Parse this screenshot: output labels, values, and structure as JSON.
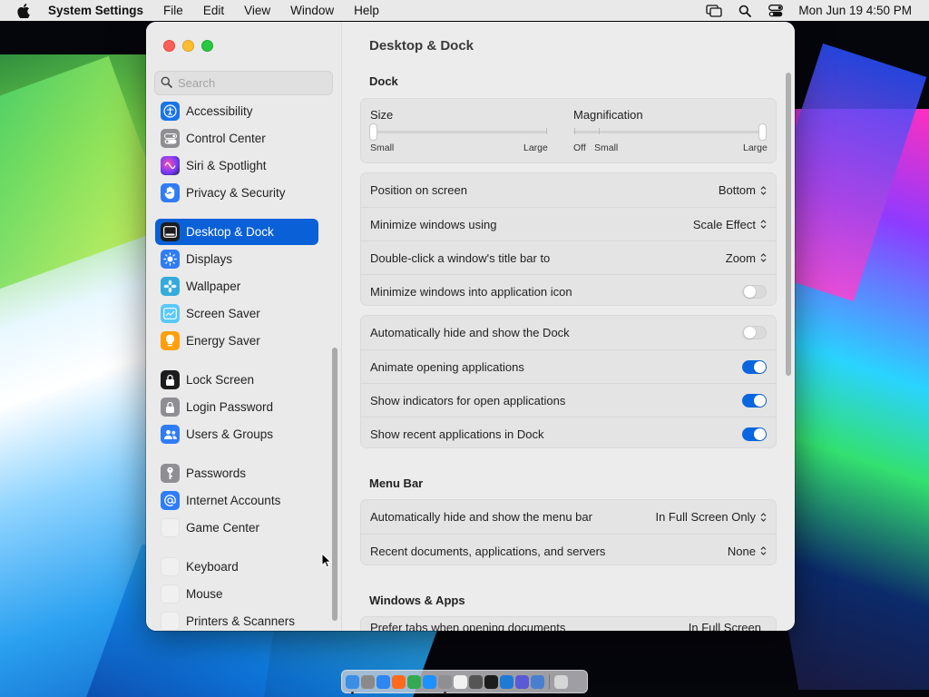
{
  "menubar": {
    "app_name": "System Settings",
    "menus": [
      "File",
      "Edit",
      "View",
      "Window",
      "Help"
    ],
    "clock": "Mon Jun 19  4:50 PM",
    "icons": [
      "apple-logo-icon",
      "screen-mirroring-icon",
      "spotlight-search-icon",
      "control-center-icon"
    ]
  },
  "sidebar": {
    "search_placeholder": "Search",
    "items": [
      {
        "label": "Accessibility",
        "icon": "accessibility-icon",
        "color": "#1a73e8"
      },
      {
        "label": "Control Center",
        "icon": "control-center-icon",
        "color": "#8e8e93"
      },
      {
        "label": "Siri & Spotlight",
        "icon": "siri-icon",
        "color": "#b04fd8"
      },
      {
        "label": "Privacy & Security",
        "icon": "hand-icon",
        "color": "#2f7cf6"
      },
      {
        "label": "Desktop & Dock",
        "icon": "dock-icon",
        "color": "#1c1c1e",
        "active": true
      },
      {
        "label": "Displays",
        "icon": "sun-icon",
        "color": "#2f7cf6"
      },
      {
        "label": "Wallpaper",
        "icon": "flower-icon",
        "color": "#35aadc"
      },
      {
        "label": "Screen Saver",
        "icon": "screen-saver-icon",
        "color": "#5ac8fa"
      },
      {
        "label": "Energy Saver",
        "icon": "lightbulb-icon",
        "color": "#ff9f0a"
      },
      {
        "label": "Lock Screen",
        "icon": "lock-screen-icon",
        "color": "#1c1c1e"
      },
      {
        "label": "Login Password",
        "icon": "lock-icon",
        "color": "#8e8e93"
      },
      {
        "label": "Users & Groups",
        "icon": "users-icon",
        "color": "#2f7cf6"
      },
      {
        "label": "Passwords",
        "icon": "key-icon",
        "color": "#8e8e93"
      },
      {
        "label": "Internet Accounts",
        "icon": "at-sign-icon",
        "color": "#2f7cf6"
      },
      {
        "label": "Game Center",
        "icon": "game-center-icon",
        "color": "#f0f0f0"
      },
      {
        "label": "Keyboard",
        "icon": "keyboard-icon",
        "color": "#f0f0f0"
      },
      {
        "label": "Mouse",
        "icon": "mouse-icon",
        "color": "#f0f0f0"
      },
      {
        "label": "Printers & Scanners",
        "icon": "printer-icon",
        "color": "#f0f0f0"
      }
    ]
  },
  "content": {
    "title": "Desktop & Dock",
    "dock_section": {
      "title": "Dock",
      "size": {
        "label": "Size",
        "min_label": "Small",
        "max_label": "Large",
        "value": 0.0
      },
      "magnification": {
        "label": "Magnification",
        "off_label": "Off",
        "min_label": "Small",
        "max_label": "Large",
        "value": 1.0
      },
      "rows": [
        {
          "label": "Position on screen",
          "value": "Bottom"
        },
        {
          "label": "Minimize windows using",
          "value": "Scale Effect"
        },
        {
          "label": "Double-click a window's title bar to",
          "value": "Zoom"
        },
        {
          "label": "Minimize windows into application icon",
          "toggle": false
        }
      ],
      "toggles": [
        {
          "label": "Automatically hide and show the Dock",
          "on": false
        },
        {
          "label": "Animate opening applications",
          "on": true
        },
        {
          "label": "Show indicators for open applications",
          "on": true
        },
        {
          "label": "Show recent applications in Dock",
          "on": true
        }
      ]
    },
    "menubar_section": {
      "title": "Menu Bar",
      "rows": [
        {
          "label": "Automatically hide and show the menu bar",
          "value": "In Full Screen Only"
        },
        {
          "label": "Recent documents, applications, and servers",
          "value": "None"
        }
      ]
    },
    "windows_section": {
      "title": "Windows & Apps",
      "partial_row": {
        "label": "Prefer tabs when opening documents",
        "value": "In Full Screen"
      }
    }
  },
  "colors": {
    "accent": "#0a60d6",
    "toggle_on": "#0a66e0",
    "close": "#fe5f57",
    "minimize": "#febc2e",
    "zoom": "#28c840"
  },
  "dock": {
    "apps": [
      {
        "name": "finder-icon",
        "color": "#3a8ee6"
      },
      {
        "name": "launchpad-icon",
        "color": "#8a8a8a"
      },
      {
        "name": "safari-icon",
        "color": "#2e86f0"
      },
      {
        "name": "firefox-icon",
        "color": "#ff6a1e"
      },
      {
        "name": "chrome-icon",
        "color": "#34a853"
      },
      {
        "name": "app-store-icon",
        "color": "#1e90ff"
      },
      {
        "name": "system-settings-icon",
        "color": "#8e8e93"
      },
      {
        "name": "textedit-icon",
        "color": "#f2f2f2"
      },
      {
        "name": "script-editor-icon",
        "color": "#555555"
      },
      {
        "name": "terminal-icon",
        "color": "#1c1c1c"
      },
      {
        "name": "vscode-icon",
        "color": "#1f7ad6"
      },
      {
        "name": "remote-desktop-icon",
        "color": "#5a5ad6"
      },
      {
        "name": "preview-icon",
        "color": "#4a7fd0"
      },
      {
        "name": "trash-icon",
        "color": "#d6d6d6"
      }
    ]
  }
}
